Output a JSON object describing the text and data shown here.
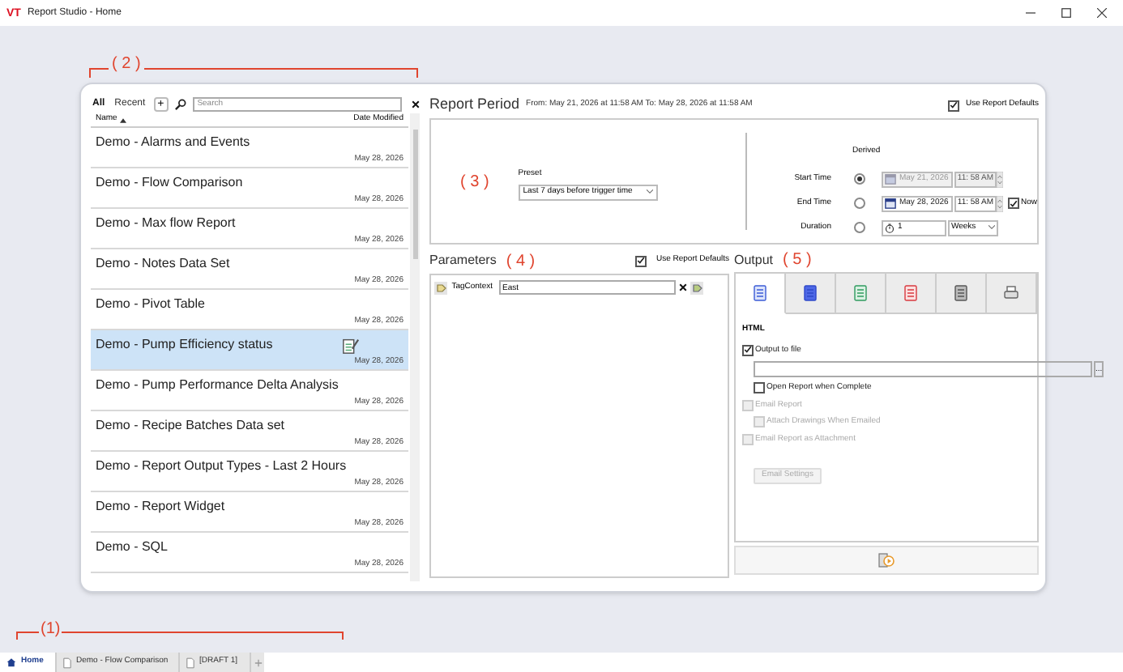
{
  "window": {
    "logo": "VT",
    "title": "Report Studio - Home"
  },
  "list_panel": {
    "annotation": "( 2 )",
    "filters": [
      {
        "label": "All",
        "selected": true
      },
      {
        "label": "Recent",
        "selected": false
      }
    ],
    "add_button": "+",
    "search": {
      "placeholder": "Search"
    },
    "columns": [
      "Name",
      "Date Modified"
    ],
    "items": [
      {
        "title": "Demo - Alarms and Events",
        "date": "May 28, 2026",
        "selected": false
      },
      {
        "title": "Demo - Flow Comparison",
        "date": "May 28, 2026",
        "selected": false
      },
      {
        "title": "Demo - Max flow Report",
        "date": "May 28, 2026",
        "selected": false
      },
      {
        "title": "Demo - Notes Data Set",
        "date": "May 28, 2026",
        "selected": false
      },
      {
        "title": "Demo - Pivot Table",
        "date": "May 28, 2026",
        "selected": false
      },
      {
        "title": "Demo - Pump Efficiency status",
        "date": "May 28, 2026",
        "selected": true
      },
      {
        "title": "Demo - Pump Performance Delta Analysis",
        "date": "May 28, 2026",
        "selected": false
      },
      {
        "title": "Demo - Recipe Batches Data set",
        "date": "May 28, 2026",
        "selected": false
      },
      {
        "title": "Demo - Report Output Types - Last 2 Hours",
        "date": "May 28, 2026",
        "selected": false
      },
      {
        "title": "Demo - Report Widget",
        "date": "May 28, 2026",
        "selected": false
      },
      {
        "title": "Demo - SQL",
        "date": "May 28, 2026",
        "selected": false
      }
    ]
  },
  "report_period": {
    "title": "Report Period",
    "range": "From: May 21, 2026 at 11:58 AM To: May 28, 2026 at 11:58 AM",
    "use_defaults": {
      "label": "Use Report Defaults",
      "checked": true
    },
    "annotation": "( 3 )",
    "preset": {
      "label": "Preset",
      "value": "Last 7 days before trigger time"
    },
    "derived_label": "Derived",
    "rows": [
      {
        "kind": "time",
        "label": "Start Time",
        "selected": true,
        "disabled": true,
        "date": "May 21, 2026",
        "time": "11: 58 AM"
      },
      {
        "kind": "time",
        "label": "End Time",
        "selected": false,
        "disabled": false,
        "date": "May 28, 2026",
        "time": "11: 58 AM",
        "now": {
          "label": "Now",
          "checked": true
        }
      },
      {
        "kind": "duration",
        "label": "Duration",
        "selected": false,
        "value": "1",
        "unit": "Weeks"
      }
    ]
  },
  "parameters": {
    "title": "Parameters",
    "annotation": "( 4 )",
    "use_defaults": {
      "label": "Use Report Defaults",
      "checked": true
    },
    "rows": [
      {
        "label": "TagContext",
        "value": "East"
      }
    ]
  },
  "output": {
    "title": "Output",
    "annotation": "( 5 )",
    "tabs": [
      {
        "kind": "html",
        "selected": true
      },
      {
        "kind": "table",
        "selected": false
      },
      {
        "kind": "excel",
        "selected": false
      },
      {
        "kind": "pdf",
        "selected": false
      },
      {
        "kind": "calculator",
        "selected": false
      },
      {
        "kind": "printer",
        "selected": false
      }
    ],
    "format_title": "HTML",
    "browse_button": "...",
    "options": [
      {
        "kind": "checkbox",
        "label": "Output to file",
        "checked": true,
        "disabled": false,
        "indent": false
      },
      {
        "kind": "path"
      },
      {
        "kind": "checkbox",
        "label": "Open Report when Complete",
        "checked": false,
        "disabled": false,
        "indent": true
      },
      {
        "kind": "checkbox",
        "label": "Email Report",
        "checked": false,
        "disabled": true,
        "indent": false
      },
      {
        "kind": "checkbox",
        "label": "Attach Drawings When Emailed",
        "checked": false,
        "disabled": true,
        "indent": true
      },
      {
        "kind": "checkbox",
        "label": "Email Report as Attachment",
        "checked": false,
        "disabled": true,
        "indent": false
      },
      {
        "kind": "button",
        "label": "Email Settings",
        "disabled": true
      }
    ]
  },
  "tab_bar": {
    "annotation": "(1)",
    "tabs": [
      {
        "kind": "home",
        "label": "Home",
        "selected": true
      },
      {
        "kind": "document",
        "label": "Demo - Flow Comparison",
        "selected": false
      },
      {
        "kind": "document",
        "label": "[DRAFT 1]",
        "selected": false
      }
    ]
  }
}
